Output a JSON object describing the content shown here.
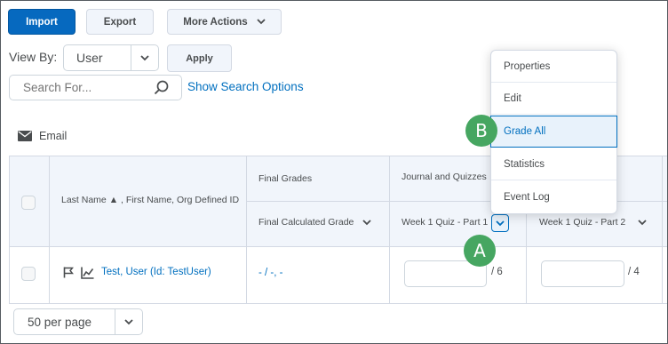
{
  "toolbar": {
    "import_label": "Import",
    "export_label": "Export",
    "more_actions_label": "More Actions"
  },
  "view_by": {
    "label": "View By:",
    "selected": "User",
    "apply_label": "Apply"
  },
  "search": {
    "placeholder": "Search For...",
    "show_options_label": "Show Search Options"
  },
  "email_label": "Email",
  "table": {
    "name_header": "Last Name ▲ , First Name, Org Defined ID",
    "final_grades_header": "Final Grades",
    "final_calculated_header": "Final Calculated Grade",
    "journal_header": "Journal and Quizzes",
    "col1_header": "Week 1 Quiz - Part 1",
    "col2_header": "Week 1 Quiz - Part 2",
    "row": {
      "user_link": "Test, User (Id: TestUser)",
      "final_value": "- / -, -",
      "col1_max": "/ 6",
      "col2_max": "/ 4"
    }
  },
  "per_page": "50 per page",
  "context_menu": {
    "items": [
      "Properties",
      "Edit",
      "Grade All",
      "Statistics",
      "Event Log"
    ]
  },
  "callouts": {
    "a": "A",
    "b": "B"
  },
  "colors": {
    "primary": "#0669bf",
    "link": "#006fbf",
    "callout": "#46a661"
  }
}
